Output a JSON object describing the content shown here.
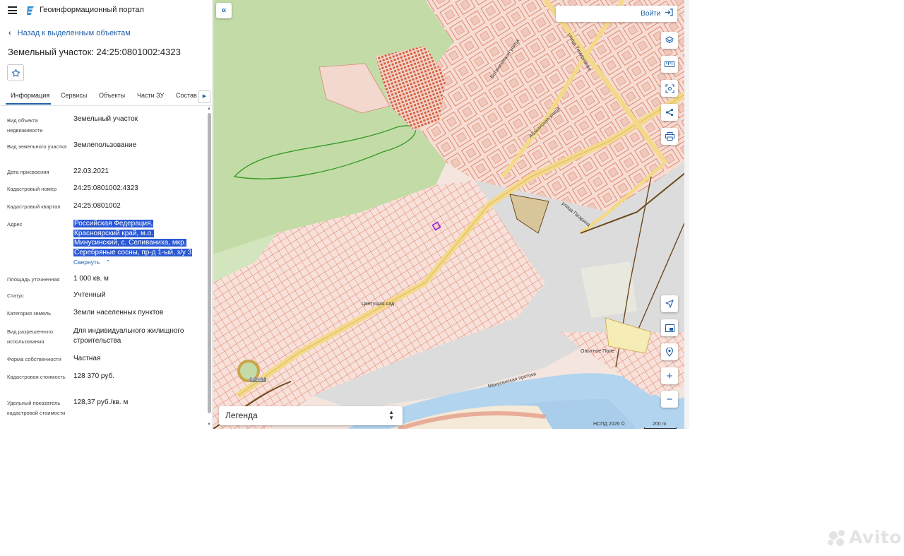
{
  "app": {
    "title": "Геоинформационный портал",
    "accent_color": "#1f5fa8"
  },
  "nav": {
    "back_label": "Назад к выделенным объектам"
  },
  "object": {
    "title": "Земельный участок: 24:25:0801002:4323"
  },
  "tabs": [
    {
      "label": "Информация",
      "active": true
    },
    {
      "label": "Сервисы",
      "active": false
    },
    {
      "label": "Объекты",
      "active": false
    },
    {
      "label": "Части ЗУ",
      "active": false
    },
    {
      "label": "Состав",
      "active": false
    }
  ],
  "properties": [
    {
      "label": "Вид объекта недвижимости",
      "value": "Земельный участок"
    },
    {
      "label": "Вид земельного участка",
      "value": "Землепользование"
    },
    {
      "label": "Дата присвоения",
      "value": "22.03.2021"
    },
    {
      "label": "Кадастровый номер",
      "value": "24:25:0801002:4323"
    },
    {
      "label": "Кадастровый квартал",
      "value": "24:25:0801002"
    },
    {
      "label": "Адрес",
      "value": "Российская Федерация, Красноярский край, м.о. Минусинский, с. Селиваниха, мкр. Серебряные сосны, пр-д 1-ый, з/у 3"
    },
    {
      "label": "Площадь уточненная",
      "value": "1 000 кв. м"
    },
    {
      "label": "Статус",
      "value": "Учтенный"
    },
    {
      "label": "Категория земель",
      "value": "Земли населенных пунктов"
    },
    {
      "label": "Вид разрешенного использования",
      "value": "Для индивидуального жилищного строительства"
    },
    {
      "label": "Форма собственности",
      "value": "Частная"
    },
    {
      "label": "Кадастровая стоимость",
      "value": "128 370 руб."
    },
    {
      "label": "Удельный показатель кадастровой стоимости",
      "value": "128,37 руб./кв. м"
    }
  ],
  "address_lines": [
    "Российская Федерация,",
    "Красноярский край, м.о.",
    "Минусинский, с. Селиваниха, мкр.",
    "Серебряные сосны, пр-д 1-ый, з/у 3"
  ],
  "collapse_label": "Свернуть",
  "map": {
    "login_label": "Войти",
    "legend_label": "Легенда",
    "attribution": "НСПД 2026 ©",
    "scale_label": "200 m",
    "street_labels": [
      "улица Тимирязева",
      "Абаканская улица",
      "улица Гагарина",
      "Ботаническая улица",
      "Минусинская протока",
      "Опытное Поле",
      "Цветущая сад"
    ],
    "road_badge": "Р-257"
  },
  "watermark": "Avito"
}
